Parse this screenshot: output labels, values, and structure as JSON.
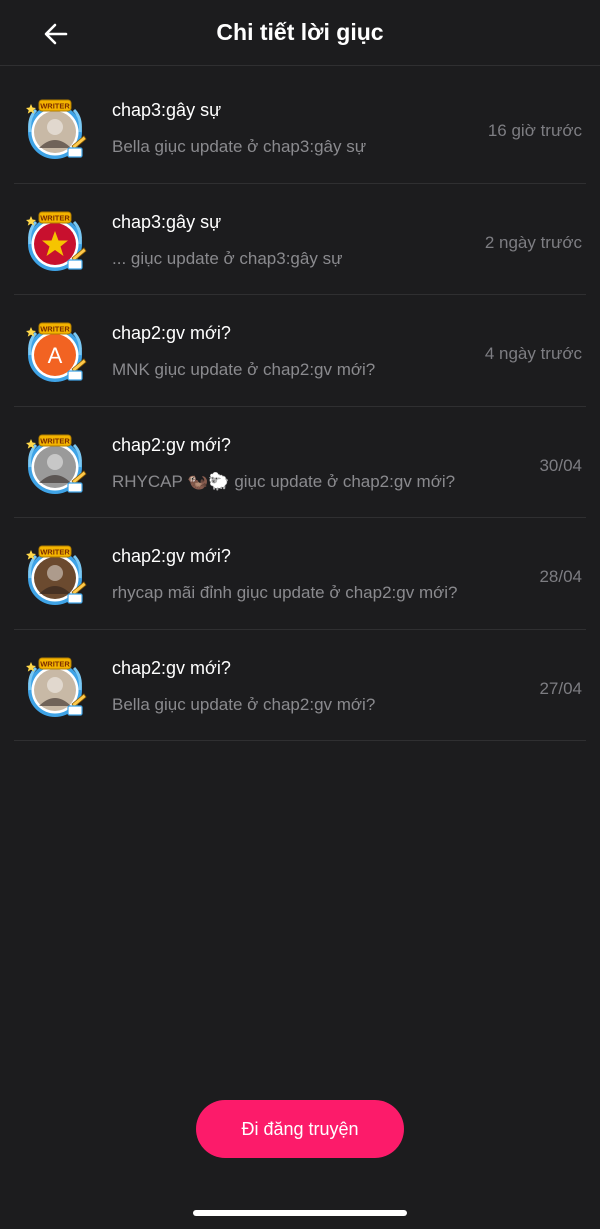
{
  "header": {
    "title": "Chi tiết lời giục",
    "back_icon": "arrow-left-icon"
  },
  "items": [
    {
      "title": "chap3:gây sự",
      "subtitle": "Bella giục update ở chap3:gây sự",
      "time": "16 giờ trước",
      "avatar_badge": "WRITER",
      "avatar_style": "photo",
      "avatar_color": "#c8b9a6"
    },
    {
      "title": "chap3:gây sự",
      "subtitle": "... giục update ở chap3:gây sự",
      "time": "2 ngày trước",
      "avatar_badge": "WRITER",
      "avatar_style": "flag",
      "avatar_color": "#c8102e"
    },
    {
      "title": "chap2:gv mới?",
      "subtitle": "MNK giục update ở chap2:gv mới?",
      "time": "4 ngày trước",
      "avatar_badge": "WRITER",
      "avatar_style": "letter",
      "avatar_letter": "A",
      "avatar_color": "#f26322"
    },
    {
      "title": "chap2:gv mới?",
      "subtitle": "RHYCAP 🦦🐑 giục update ở chap2:gv mới?",
      "time": "30/04",
      "avatar_badge": "WRITER",
      "avatar_style": "photo",
      "avatar_color": "#9a9a9a"
    },
    {
      "title": "chap2:gv mới?",
      "subtitle": "rhycap mãi đỉnh giục update ở chap2:gv mới?",
      "time": "28/04",
      "avatar_badge": "WRITER",
      "avatar_style": "photo",
      "avatar_color": "#6b4a2f"
    },
    {
      "title": "chap2:gv mới?",
      "subtitle": "Bella giục update ở chap2:gv mới?",
      "time": "27/04",
      "avatar_badge": "WRITER",
      "avatar_style": "photo",
      "avatar_color": "#c8b9a6"
    }
  ],
  "cta": {
    "label": "Đi đăng truyện",
    "color": "#fc1b6a"
  },
  "colors": {
    "background": "#1c1c1e",
    "divider": "#2f2f31",
    "frame_blue": "#3fa3e6",
    "badge_gold": "#f4b400"
  }
}
